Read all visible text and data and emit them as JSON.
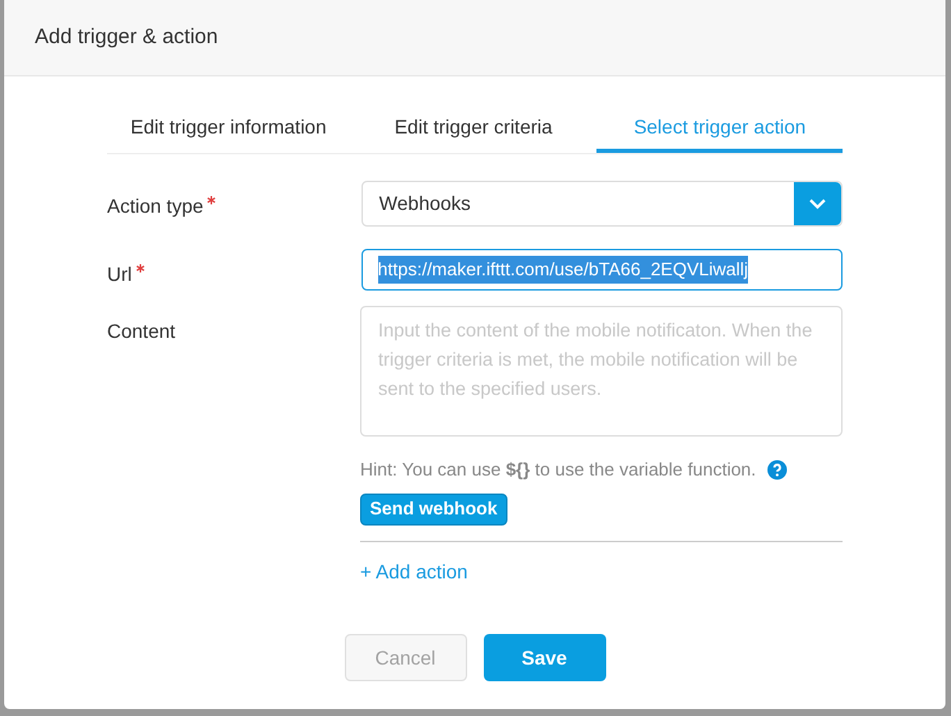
{
  "dialog": {
    "title": "Add trigger & action"
  },
  "tabs": [
    {
      "label": "Edit trigger information",
      "selected": false
    },
    {
      "label": "Edit trigger criteria",
      "selected": false
    },
    {
      "label": "Select trigger action",
      "selected": true
    }
  ],
  "form": {
    "action_type": {
      "label": "Action type",
      "required": true,
      "value": "Webhooks"
    },
    "url": {
      "label": "Url",
      "required": true,
      "value": "https://maker.ifttt.com/use/bTA66_2EQVLiwallj",
      "selected": true
    },
    "content": {
      "label": "Content",
      "placeholder": "Input the content of the mobile notificaton. When the trigger criteria is met, the mobile notification will be sent to the specified users."
    },
    "hint": "Hint: You can use **${}** to use the variable function.",
    "send_button": "Send webhook",
    "add_action": "+ Add action"
  },
  "buttons": [
    {
      "label": "Cancel",
      "disabled": true
    },
    {
      "label": "Save",
      "disabled": false
    }
  ]
}
